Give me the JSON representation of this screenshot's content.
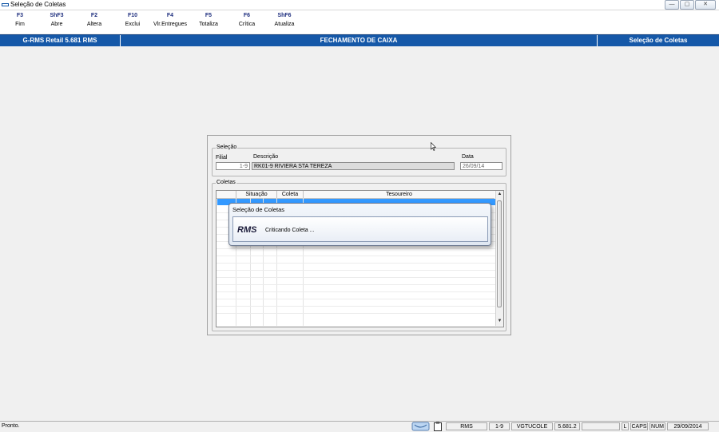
{
  "window": {
    "title": "Seleção de Coletas",
    "minimize": "—",
    "maximize": "▢",
    "close": "✕"
  },
  "toolbar": {
    "buttons": [
      {
        "key": "F3",
        "label": "Fim"
      },
      {
        "key": "ShF3",
        "label": "Abre"
      },
      {
        "key": "F2",
        "label": "Altera"
      },
      {
        "key": "F10",
        "label": "Exclui"
      },
      {
        "key": "F4",
        "label": "Vlr.Entregues"
      },
      {
        "key": "F5",
        "label": "Totaliza"
      },
      {
        "key": "F6",
        "label": "Crítica"
      },
      {
        "key": "ShF6",
        "label": "Atualiza"
      }
    ]
  },
  "header": {
    "app": "G-RMS Retail 5.681 RMS",
    "module": "FECHAMENTO DE CAIXA",
    "screen": "Seleção de Coletas"
  },
  "selecao": {
    "legend": "Seleção",
    "filial_label": "Filial",
    "filial_value": "1-9",
    "descricao_label": "Descrição",
    "descricao_value": "RK01-9 RIVIERA STA TEREZA",
    "data_label": "Data",
    "data_value": "26/09/14"
  },
  "coletas": {
    "legend": "Coletas",
    "columns": [
      "Situação",
      "Coleta",
      "Tesoureiro"
    ]
  },
  "dialog": {
    "title": "Seleção de Coletas",
    "logo": "RMS",
    "message": "Criticando Coleta ..."
  },
  "statusbar": {
    "text": "Pronto.",
    "cells": [
      "RMS",
      "1-9",
      "VGTUCOLE",
      "5.681.2",
      "",
      "L",
      "CAPS",
      "NUM",
      "29/09/2014"
    ]
  },
  "colors": {
    "header_bar": "#1558a8",
    "selection": "#3399ff",
    "toolbar_key": "#1f2f7f"
  }
}
